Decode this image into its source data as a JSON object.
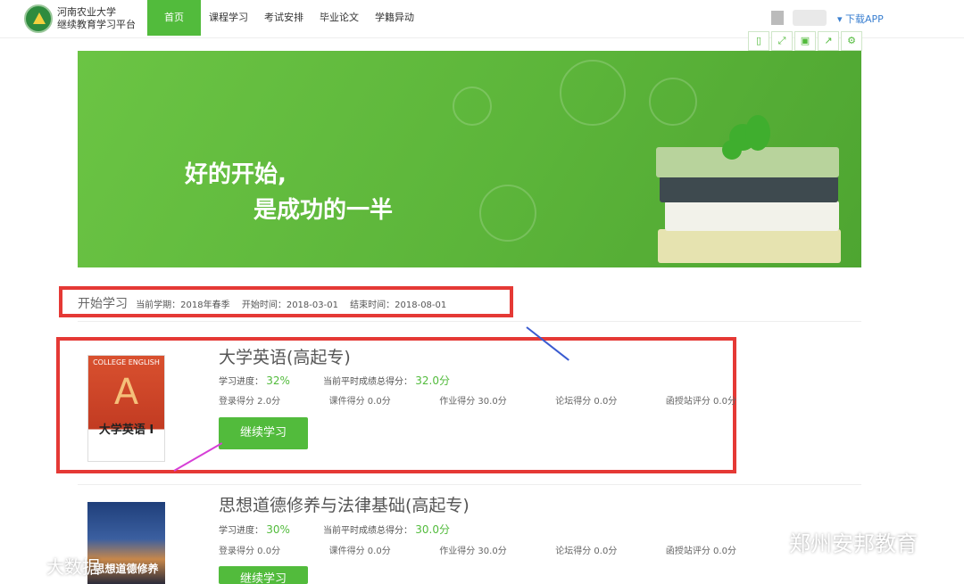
{
  "header": {
    "school": "河南农业大学",
    "platform": "继续教育学习平台",
    "nav": [
      "首页",
      "课程学习",
      "考试安排",
      "毕业论文",
      "学籍异动"
    ],
    "download": "▾ 下载APP"
  },
  "banner": {
    "line1": "好的开始,",
    "line2": "是成功的一半"
  },
  "term": {
    "heading": "开始学习",
    "semester": "当前学期：2018年春季",
    "start": "开始时间：2018-03-01",
    "end": "结束时间：2018-08-01"
  },
  "courses": [
    {
      "title": "大学英语(高起专)",
      "cover_top": "COLLEGE ENGLISH",
      "cover_bottom": "大学英语 I",
      "progress_label": "学习进度：",
      "progress": "32%",
      "total_label": "当前平时成绩总得分：",
      "total": "32.0分",
      "scores": [
        "登录得分 2.0分",
        "课件得分 0.0分",
        "作业得分 30.0分",
        "论坛得分 0.0分",
        "函授站评分 0.0分"
      ],
      "button": "继续学习"
    },
    {
      "title": "思想道德修养与法律基础(高起专)",
      "cover_bottom": "思想道德修养",
      "progress_label": "学习进度：",
      "progress": "30%",
      "total_label": "当前平时成绩总得分：",
      "total": "30.0分",
      "scores": [
        "登录得分 0.0分",
        "课件得分 0.0分",
        "作业得分 30.0分",
        "论坛得分 0.0分",
        "函授站评分 0.0分"
      ],
      "button": "继续学习"
    }
  ],
  "watermarks": {
    "left": "大数据",
    "right": "郑州安邦教育"
  },
  "colors": {
    "accent": "#52bb3c",
    "annotation": "#e53935"
  }
}
